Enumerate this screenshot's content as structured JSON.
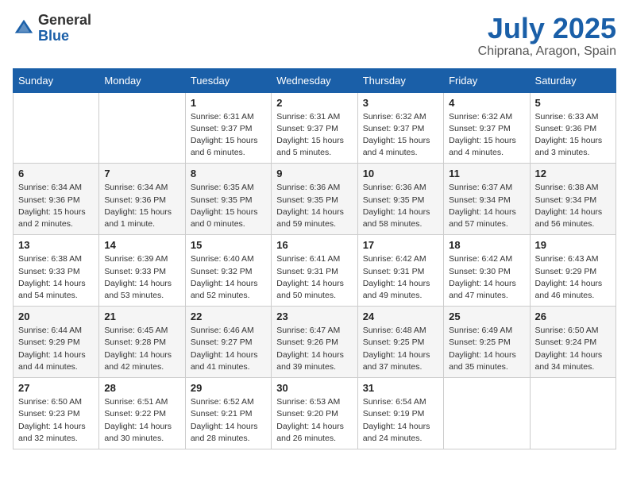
{
  "header": {
    "logo_general": "General",
    "logo_blue": "Blue",
    "month": "July 2025",
    "location": "Chiprana, Aragon, Spain"
  },
  "weekdays": [
    "Sunday",
    "Monday",
    "Tuesday",
    "Wednesday",
    "Thursday",
    "Friday",
    "Saturday"
  ],
  "weeks": [
    [
      {
        "day": "",
        "info": ""
      },
      {
        "day": "",
        "info": ""
      },
      {
        "day": "1",
        "info": "Sunrise: 6:31 AM\nSunset: 9:37 PM\nDaylight: 15 hours and 6 minutes."
      },
      {
        "day": "2",
        "info": "Sunrise: 6:31 AM\nSunset: 9:37 PM\nDaylight: 15 hours and 5 minutes."
      },
      {
        "day": "3",
        "info": "Sunrise: 6:32 AM\nSunset: 9:37 PM\nDaylight: 15 hours and 4 minutes."
      },
      {
        "day": "4",
        "info": "Sunrise: 6:32 AM\nSunset: 9:37 PM\nDaylight: 15 hours and 4 minutes."
      },
      {
        "day": "5",
        "info": "Sunrise: 6:33 AM\nSunset: 9:36 PM\nDaylight: 15 hours and 3 minutes."
      }
    ],
    [
      {
        "day": "6",
        "info": "Sunrise: 6:34 AM\nSunset: 9:36 PM\nDaylight: 15 hours and 2 minutes."
      },
      {
        "day": "7",
        "info": "Sunrise: 6:34 AM\nSunset: 9:36 PM\nDaylight: 15 hours and 1 minute."
      },
      {
        "day": "8",
        "info": "Sunrise: 6:35 AM\nSunset: 9:35 PM\nDaylight: 15 hours and 0 minutes."
      },
      {
        "day": "9",
        "info": "Sunrise: 6:36 AM\nSunset: 9:35 PM\nDaylight: 14 hours and 59 minutes."
      },
      {
        "day": "10",
        "info": "Sunrise: 6:36 AM\nSunset: 9:35 PM\nDaylight: 14 hours and 58 minutes."
      },
      {
        "day": "11",
        "info": "Sunrise: 6:37 AM\nSunset: 9:34 PM\nDaylight: 14 hours and 57 minutes."
      },
      {
        "day": "12",
        "info": "Sunrise: 6:38 AM\nSunset: 9:34 PM\nDaylight: 14 hours and 56 minutes."
      }
    ],
    [
      {
        "day": "13",
        "info": "Sunrise: 6:38 AM\nSunset: 9:33 PM\nDaylight: 14 hours and 54 minutes."
      },
      {
        "day": "14",
        "info": "Sunrise: 6:39 AM\nSunset: 9:33 PM\nDaylight: 14 hours and 53 minutes."
      },
      {
        "day": "15",
        "info": "Sunrise: 6:40 AM\nSunset: 9:32 PM\nDaylight: 14 hours and 52 minutes."
      },
      {
        "day": "16",
        "info": "Sunrise: 6:41 AM\nSunset: 9:31 PM\nDaylight: 14 hours and 50 minutes."
      },
      {
        "day": "17",
        "info": "Sunrise: 6:42 AM\nSunset: 9:31 PM\nDaylight: 14 hours and 49 minutes."
      },
      {
        "day": "18",
        "info": "Sunrise: 6:42 AM\nSunset: 9:30 PM\nDaylight: 14 hours and 47 minutes."
      },
      {
        "day": "19",
        "info": "Sunrise: 6:43 AM\nSunset: 9:29 PM\nDaylight: 14 hours and 46 minutes."
      }
    ],
    [
      {
        "day": "20",
        "info": "Sunrise: 6:44 AM\nSunset: 9:29 PM\nDaylight: 14 hours and 44 minutes."
      },
      {
        "day": "21",
        "info": "Sunrise: 6:45 AM\nSunset: 9:28 PM\nDaylight: 14 hours and 42 minutes."
      },
      {
        "day": "22",
        "info": "Sunrise: 6:46 AM\nSunset: 9:27 PM\nDaylight: 14 hours and 41 minutes."
      },
      {
        "day": "23",
        "info": "Sunrise: 6:47 AM\nSunset: 9:26 PM\nDaylight: 14 hours and 39 minutes."
      },
      {
        "day": "24",
        "info": "Sunrise: 6:48 AM\nSunset: 9:25 PM\nDaylight: 14 hours and 37 minutes."
      },
      {
        "day": "25",
        "info": "Sunrise: 6:49 AM\nSunset: 9:25 PM\nDaylight: 14 hours and 35 minutes."
      },
      {
        "day": "26",
        "info": "Sunrise: 6:50 AM\nSunset: 9:24 PM\nDaylight: 14 hours and 34 minutes."
      }
    ],
    [
      {
        "day": "27",
        "info": "Sunrise: 6:50 AM\nSunset: 9:23 PM\nDaylight: 14 hours and 32 minutes."
      },
      {
        "day": "28",
        "info": "Sunrise: 6:51 AM\nSunset: 9:22 PM\nDaylight: 14 hours and 30 minutes."
      },
      {
        "day": "29",
        "info": "Sunrise: 6:52 AM\nSunset: 9:21 PM\nDaylight: 14 hours and 28 minutes."
      },
      {
        "day": "30",
        "info": "Sunrise: 6:53 AM\nSunset: 9:20 PM\nDaylight: 14 hours and 26 minutes."
      },
      {
        "day": "31",
        "info": "Sunrise: 6:54 AM\nSunset: 9:19 PM\nDaylight: 14 hours and 24 minutes."
      },
      {
        "day": "",
        "info": ""
      },
      {
        "day": "",
        "info": ""
      }
    ]
  ]
}
